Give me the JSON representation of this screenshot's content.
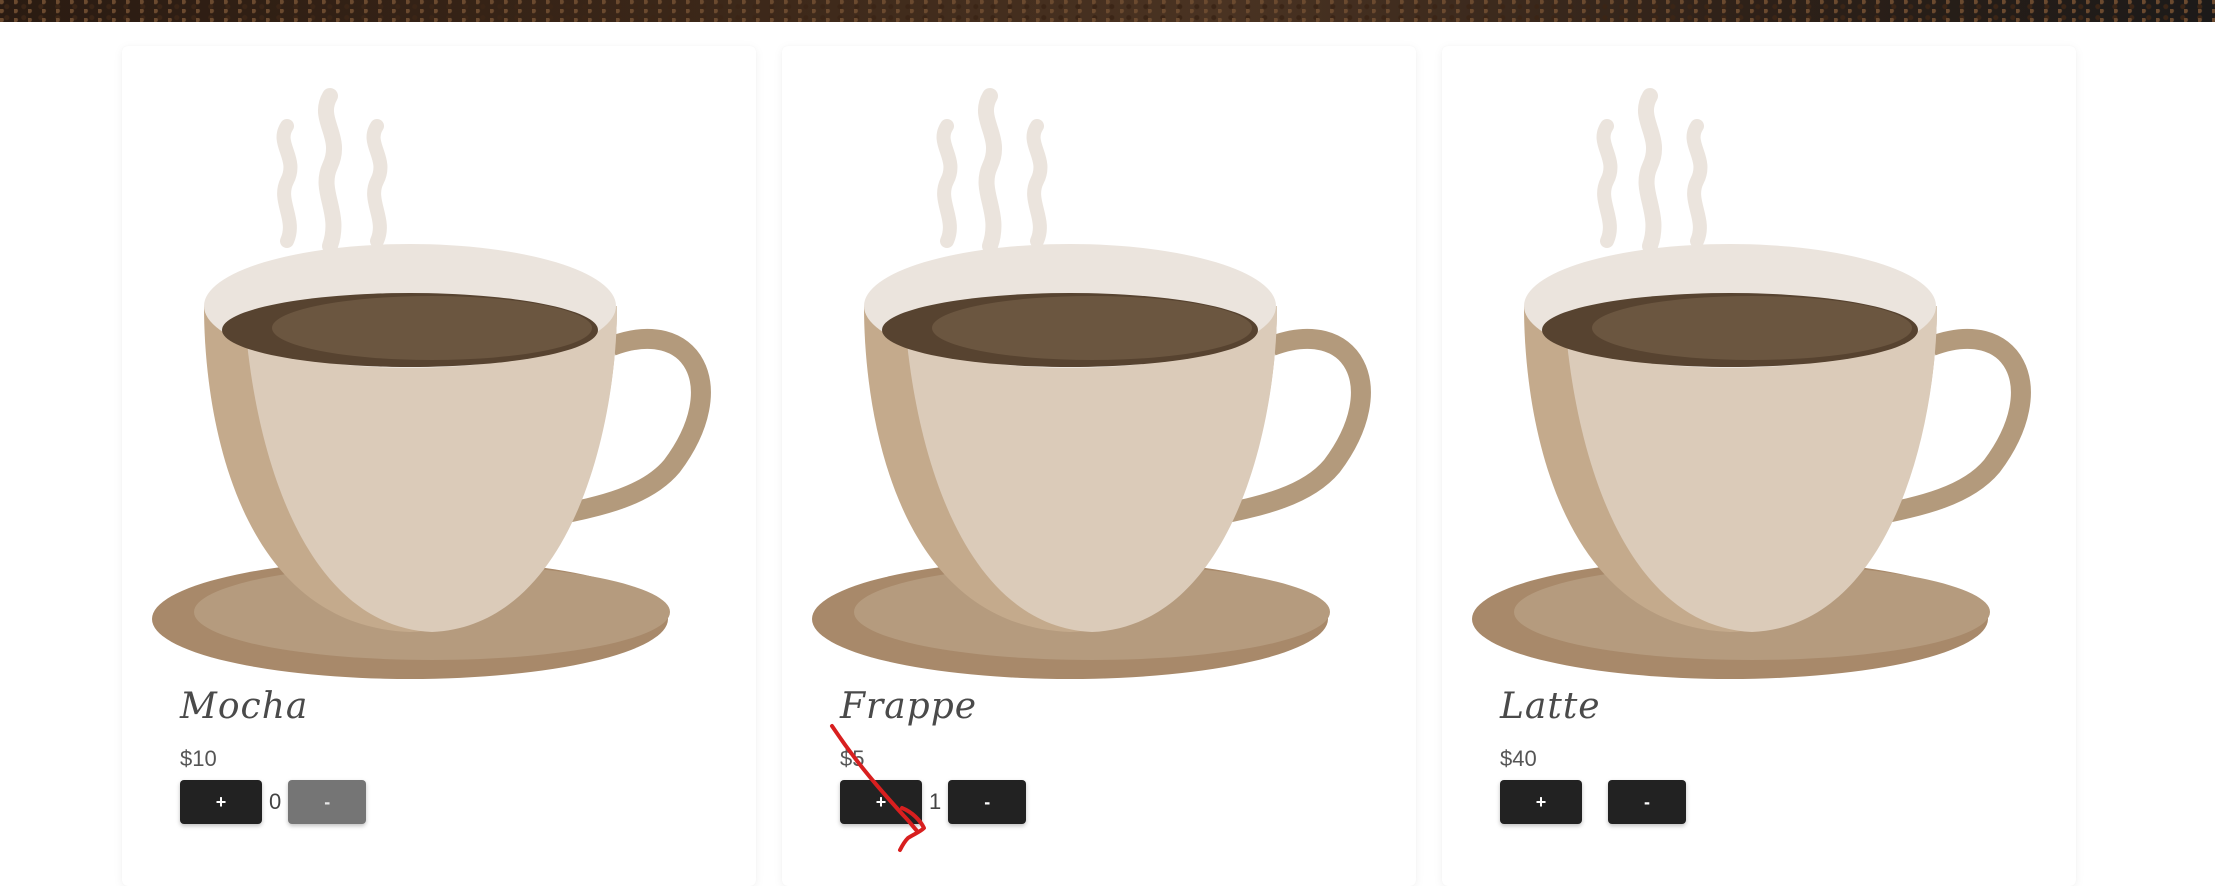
{
  "products": [
    {
      "name": "Mocha",
      "price": "$10",
      "quantity": "0",
      "plus_label": "+",
      "minus_label": "-",
      "minus_disabled": true
    },
    {
      "name": "Frappe",
      "price": "$5",
      "quantity": "1",
      "plus_label": "+",
      "minus_label": "-",
      "minus_disabled": false
    },
    {
      "name": "Latte",
      "price": "$40",
      "quantity": "",
      "plus_label": "+",
      "minus_label": "-",
      "minus_disabled": false
    }
  ],
  "icons": {
    "product_image": "coffee-cup-icon",
    "annotation": "red-arrow-icon"
  },
  "colors": {
    "button": "#222222",
    "button_disabled": "#757575",
    "annotation": "#d81f1f",
    "saucer": "#b39a7c",
    "cup": "#dbcbb9",
    "coffee": "#6b5640"
  }
}
